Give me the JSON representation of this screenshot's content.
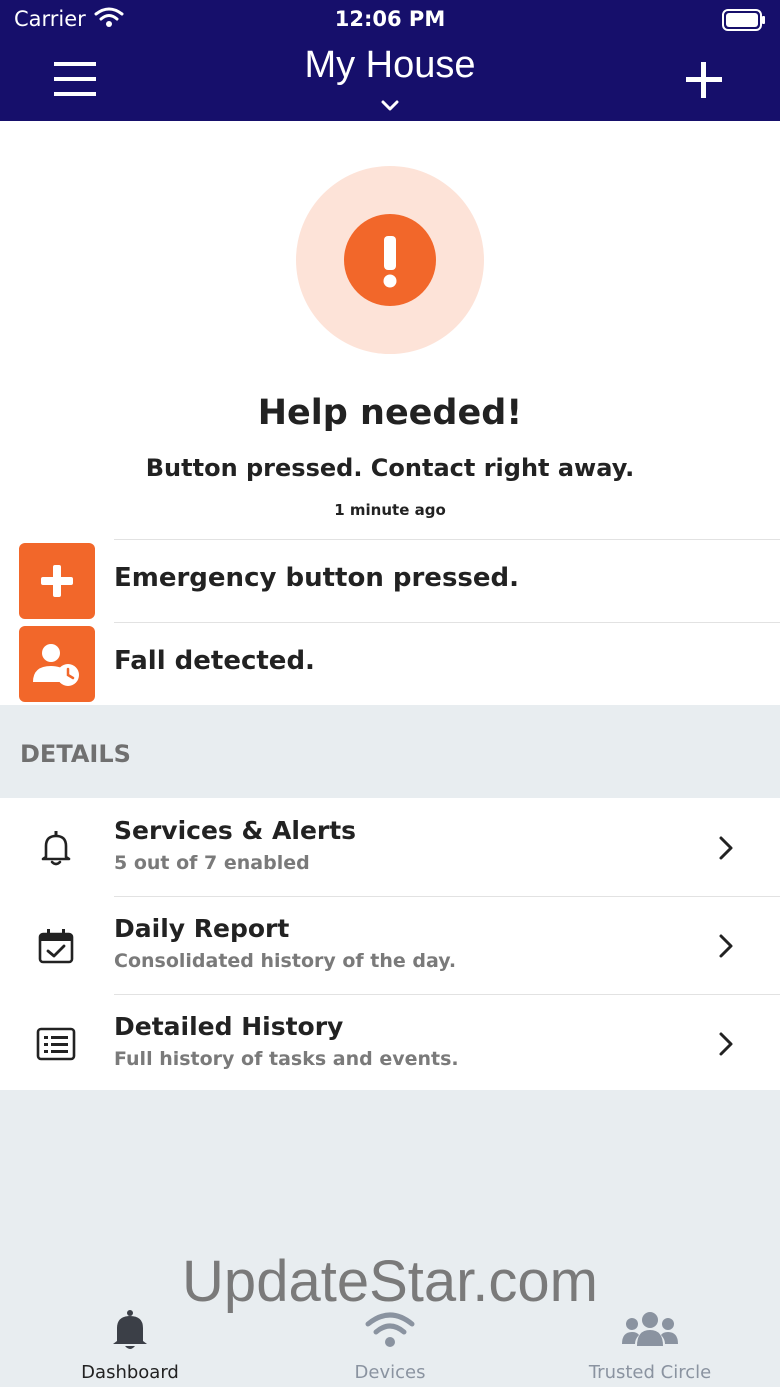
{
  "status_bar": {
    "carrier": "Carrier",
    "time": "12:06 PM"
  },
  "header": {
    "title": "My House"
  },
  "alert": {
    "title": "Help needed!",
    "subtitle": "Button pressed. Contact right away.",
    "time": "1 minute ago"
  },
  "events": [
    {
      "label": "Emergency button pressed.",
      "icon": "plus-icon"
    },
    {
      "label": "Fall detected.",
      "icon": "person-clock-icon"
    }
  ],
  "details": {
    "header": "DETAILS",
    "items": [
      {
        "title": "Services & Alerts",
        "subtitle": "5 out of 7 enabled",
        "icon": "bell-icon"
      },
      {
        "title": "Daily Report",
        "subtitle": "Consolidated history of the day.",
        "icon": "calendar-check-icon"
      },
      {
        "title": "Detailed History",
        "subtitle": "Full history of tasks and events.",
        "icon": "list-icon"
      }
    ]
  },
  "watermark": "UpdateStar.com",
  "tabs": [
    {
      "label": "Dashboard",
      "icon": "bell-icon",
      "active": true
    },
    {
      "label": "Devices",
      "icon": "wifi-icon",
      "active": false
    },
    {
      "label": "Trusted Circle",
      "icon": "group-icon",
      "active": false
    }
  ],
  "colors": {
    "header_bg": "#160f6b",
    "accent": "#f2672a",
    "accent_light": "#fde3d8",
    "section_bg": "#e8edf0"
  }
}
